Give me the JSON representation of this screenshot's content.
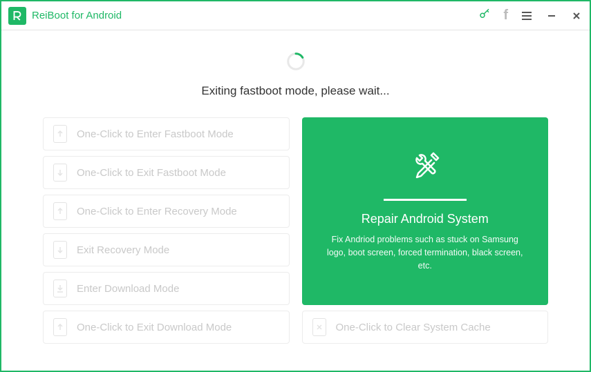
{
  "app": {
    "title": "ReiBoot for Android"
  },
  "status": {
    "message": "Exiting fastboot mode, please wait..."
  },
  "options": {
    "left": [
      {
        "label": "One-Click to Enter Fastboot Mode",
        "icon": "arrow-up"
      },
      {
        "label": "One-Click to Exit Fastboot Mode",
        "icon": "arrow-down"
      },
      {
        "label": "One-Click to Enter Recovery Mode",
        "icon": "arrow-up"
      },
      {
        "label": "Exit Recovery Mode",
        "icon": "arrow-down"
      },
      {
        "label": "Enter Download Mode",
        "icon": "download"
      },
      {
        "label": "One-Click to Exit Download Mode",
        "icon": "arrow-up"
      }
    ],
    "clear_cache": {
      "label": "One-Click to Clear System Cache"
    }
  },
  "hero": {
    "title": "Repair Android System",
    "description": "Fix Andriod problems such as stuck on Samsung logo, boot screen, forced termination, black screen, etc."
  },
  "colors": {
    "brand": "#1fb866"
  }
}
